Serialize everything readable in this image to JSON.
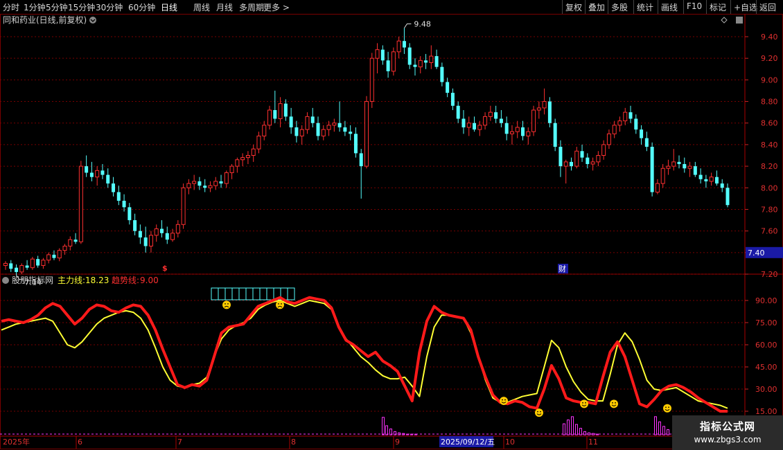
{
  "toolbar": {
    "periods": [
      "分时",
      "1分钟",
      "5分钟",
      "15分钟",
      "30分钟",
      "60分钟",
      "日线",
      "周线",
      "月线",
      "多周期",
      "更多 >"
    ],
    "active_period": "日线",
    "right_buttons": [
      "复权",
      "叠加",
      "多股",
      "统计",
      "画线",
      "F10",
      "标记",
      "+自选",
      "返回"
    ]
  },
  "main_panel": {
    "title": "同和药业(日线,前复权)",
    "high_label": "9.48",
    "low_label": "7.14",
    "current_price": "7.40",
    "marker_s": "$",
    "marker_cai": "财",
    "y_ticks": [
      "9.40",
      "9.20",
      "9.00",
      "8.80",
      "8.60",
      "8.40",
      "8.20",
      "8.00",
      "7.80",
      "7.60",
      "7.40",
      "7.20"
    ]
  },
  "indicator_panel": {
    "name": "股朋指标网",
    "line1_label": "主力线:",
    "line1_value": "18.23",
    "line2_label": "趋势线:",
    "line2_value": "9.00",
    "y_ticks": [
      "90.00",
      "75.00",
      "60.00",
      "45.00",
      "30.00",
      "15.00"
    ]
  },
  "date_axis": {
    "year_label": "2025年",
    "month_labels": [
      "6",
      "7",
      "8",
      "9",
      "10",
      "11"
    ],
    "cursor_date": "2025/09/12/五"
  },
  "watermark": {
    "line1": "指标公式网",
    "line2": "www.zbgs3.com"
  },
  "colors": {
    "up": "#ff3030",
    "down": "#54ffff",
    "trend": "#ff1a1a",
    "main": "#ffff33",
    "volume": "#ff33ff",
    "grid": "#7a0000"
  },
  "chart_data": {
    "type": "candlestick",
    "price_axis_ylim": [
      7.1,
      9.55
    ],
    "indicator_ylim": [
      8,
      102
    ],
    "candles_ohlc": [
      [
        7.28,
        7.32,
        7.24,
        7.3
      ],
      [
        7.3,
        7.33,
        7.22,
        7.25
      ],
      [
        7.26,
        7.29,
        7.19,
        7.22
      ],
      [
        7.22,
        7.3,
        7.2,
        7.28
      ],
      [
        7.28,
        7.33,
        7.24,
        7.26
      ],
      [
        7.26,
        7.36,
        7.24,
        7.34
      ],
      [
        7.34,
        7.37,
        7.26,
        7.28
      ],
      [
        7.28,
        7.35,
        7.25,
        7.33
      ],
      [
        7.33,
        7.4,
        7.3,
        7.38
      ],
      [
        7.38,
        7.42,
        7.33,
        7.35
      ],
      [
        7.35,
        7.44,
        7.32,
        7.42
      ],
      [
        7.42,
        7.48,
        7.38,
        7.46
      ],
      [
        7.46,
        7.55,
        7.42,
        7.52
      ],
      [
        7.52,
        7.58,
        7.48,
        7.5
      ],
      [
        7.5,
        8.25,
        7.48,
        8.2
      ],
      [
        8.2,
        8.3,
        8.1,
        8.14
      ],
      [
        8.14,
        8.24,
        8.06,
        8.1
      ],
      [
        8.1,
        8.2,
        8.02,
        8.16
      ],
      [
        8.16,
        8.22,
        8.08,
        8.12
      ],
      [
        8.12,
        8.18,
        8.0,
        8.04
      ],
      [
        8.04,
        8.1,
        7.92,
        7.96
      ],
      [
        7.96,
        8.02,
        7.84,
        7.88
      ],
      [
        7.88,
        7.94,
        7.78,
        7.82
      ],
      [
        7.82,
        7.86,
        7.66,
        7.7
      ],
      [
        7.7,
        7.76,
        7.56,
        7.6
      ],
      [
        7.6,
        7.66,
        7.48,
        7.54
      ],
      [
        7.54,
        7.64,
        7.4,
        7.46
      ],
      [
        7.46,
        7.6,
        7.4,
        7.56
      ],
      [
        7.56,
        7.66,
        7.5,
        7.62
      ],
      [
        7.62,
        7.7,
        7.54,
        7.58
      ],
      [
        7.58,
        7.64,
        7.48,
        7.52
      ],
      [
        7.52,
        7.62,
        7.5,
        7.58
      ],
      [
        7.58,
        7.7,
        7.54,
        7.66
      ],
      [
        7.66,
        8.04,
        7.62,
        8.0
      ],
      [
        8.0,
        8.08,
        7.94,
        8.04
      ],
      [
        8.04,
        8.12,
        7.98,
        8.06
      ],
      [
        8.06,
        8.1,
        7.98,
        8.02
      ],
      [
        8.02,
        8.08,
        7.96,
        8.0
      ],
      [
        8.0,
        8.06,
        7.96,
        8.02
      ],
      [
        8.02,
        8.1,
        7.98,
        8.06
      ],
      [
        8.06,
        8.12,
        8.0,
        8.04
      ],
      [
        8.04,
        8.16,
        8.0,
        8.14
      ],
      [
        8.14,
        8.22,
        8.08,
        8.2
      ],
      [
        8.2,
        8.28,
        8.14,
        8.26
      ],
      [
        8.26,
        8.32,
        8.2,
        8.28
      ],
      [
        8.28,
        8.34,
        8.22,
        8.3
      ],
      [
        8.3,
        8.4,
        8.24,
        8.36
      ],
      [
        8.36,
        8.52,
        8.32,
        8.48
      ],
      [
        8.48,
        8.62,
        8.44,
        8.58
      ],
      [
        8.58,
        8.76,
        8.54,
        8.72
      ],
      [
        8.72,
        8.9,
        8.6,
        8.64
      ],
      [
        8.64,
        8.84,
        8.56,
        8.78
      ],
      [
        8.78,
        8.82,
        8.62,
        8.66
      ],
      [
        8.66,
        8.74,
        8.5,
        8.56
      ],
      [
        8.56,
        8.62,
        8.42,
        8.48
      ],
      [
        8.48,
        8.58,
        8.4,
        8.54
      ],
      [
        8.54,
        8.7,
        8.5,
        8.66
      ],
      [
        8.66,
        8.74,
        8.56,
        8.6
      ],
      [
        8.6,
        8.66,
        8.44,
        8.48
      ],
      [
        8.48,
        8.58,
        8.44,
        8.54
      ],
      [
        8.54,
        8.62,
        8.48,
        8.58
      ],
      [
        8.58,
        8.64,
        8.52,
        8.6
      ],
      [
        8.6,
        8.8,
        8.52,
        8.56
      ],
      [
        8.56,
        8.62,
        8.48,
        8.52
      ],
      [
        8.52,
        8.58,
        8.44,
        8.5
      ],
      [
        8.5,
        8.56,
        8.28,
        8.32
      ],
      [
        8.32,
        8.36,
        7.9,
        8.2
      ],
      [
        8.2,
        8.85,
        8.18,
        8.8
      ],
      [
        8.8,
        9.25,
        8.74,
        9.2
      ],
      [
        9.2,
        9.34,
        9.06,
        9.28
      ],
      [
        9.28,
        9.32,
        9.14,
        9.18
      ],
      [
        9.18,
        9.26,
        9.02,
        9.08
      ],
      [
        9.08,
        9.3,
        9.04,
        9.26
      ],
      [
        9.26,
        9.4,
        9.2,
        9.36
      ],
      [
        9.36,
        9.48,
        9.24,
        9.3
      ],
      [
        9.3,
        9.34,
        9.1,
        9.14
      ],
      [
        9.14,
        9.2,
        9.04,
        9.12
      ],
      [
        9.12,
        9.22,
        9.06,
        9.18
      ],
      [
        9.18,
        9.24,
        9.1,
        9.16
      ],
      [
        9.16,
        9.32,
        9.1,
        9.22
      ],
      [
        9.22,
        9.28,
        9.1,
        9.12
      ],
      [
        9.12,
        9.16,
        8.94,
        8.98
      ],
      [
        8.98,
        9.02,
        8.84,
        8.88
      ],
      [
        8.88,
        8.92,
        8.72,
        8.76
      ],
      [
        8.76,
        8.8,
        8.6,
        8.64
      ],
      [
        8.64,
        8.72,
        8.5,
        8.56
      ],
      [
        8.56,
        8.66,
        8.48,
        8.6
      ],
      [
        8.6,
        8.66,
        8.52,
        8.54
      ],
      [
        8.54,
        8.62,
        8.48,
        8.58
      ],
      [
        8.58,
        8.7,
        8.54,
        8.66
      ],
      [
        8.66,
        8.76,
        8.62,
        8.7
      ],
      [
        8.7,
        8.76,
        8.6,
        8.64
      ],
      [
        8.64,
        8.72,
        8.56,
        8.6
      ],
      [
        8.6,
        8.66,
        8.44,
        8.5
      ],
      [
        8.5,
        8.58,
        8.4,
        8.52
      ],
      [
        8.52,
        8.62,
        8.46,
        8.56
      ],
      [
        8.56,
        8.62,
        8.44,
        8.48
      ],
      [
        8.48,
        8.56,
        8.4,
        8.52
      ],
      [
        8.52,
        8.76,
        8.48,
        8.72
      ],
      [
        8.72,
        8.8,
        8.64,
        8.74
      ],
      [
        8.74,
        8.92,
        8.68,
        8.8
      ],
      [
        8.8,
        8.84,
        8.56,
        8.6
      ],
      [
        8.6,
        8.64,
        8.34,
        8.38
      ],
      [
        8.38,
        8.44,
        8.1,
        8.2
      ],
      [
        8.2,
        8.26,
        8.04,
        8.24
      ],
      [
        8.24,
        8.28,
        8.16,
        8.2
      ],
      [
        8.2,
        8.38,
        8.18,
        8.34
      ],
      [
        8.34,
        8.4,
        8.24,
        8.28
      ],
      [
        8.28,
        8.32,
        8.18,
        8.22
      ],
      [
        8.22,
        8.28,
        8.16,
        8.24
      ],
      [
        8.24,
        8.34,
        8.2,
        8.3
      ],
      [
        8.3,
        8.44,
        8.26,
        8.4
      ],
      [
        8.4,
        8.54,
        8.36,
        8.5
      ],
      [
        8.5,
        8.62,
        8.46,
        8.58
      ],
      [
        8.58,
        8.66,
        8.52,
        8.62
      ],
      [
        8.62,
        8.74,
        8.58,
        8.7
      ],
      [
        8.7,
        8.76,
        8.6,
        8.64
      ],
      [
        8.64,
        8.68,
        8.5,
        8.54
      ],
      [
        8.54,
        8.58,
        8.4,
        8.46
      ],
      [
        8.46,
        8.52,
        8.34,
        8.38
      ],
      [
        8.38,
        8.42,
        7.92,
        7.96
      ],
      [
        7.96,
        8.08,
        7.94,
        8.04
      ],
      [
        8.04,
        8.22,
        8.0,
        8.18
      ],
      [
        8.18,
        8.26,
        8.12,
        8.2
      ],
      [
        8.2,
        8.36,
        8.16,
        8.24
      ],
      [
        8.24,
        8.3,
        8.18,
        8.22
      ],
      [
        8.22,
        8.28,
        8.14,
        8.18
      ],
      [
        8.18,
        8.24,
        8.1,
        8.2
      ],
      [
        8.2,
        8.24,
        8.1,
        8.12
      ],
      [
        8.12,
        8.18,
        8.04,
        8.08
      ],
      [
        8.08,
        8.12,
        8.0,
        8.06
      ],
      [
        8.06,
        8.14,
        8.02,
        8.1
      ],
      [
        8.1,
        8.16,
        8.02,
        8.04
      ],
      [
        8.04,
        8.08,
        7.96,
        8.0
      ],
      [
        8.0,
        8.04,
        7.82,
        7.84
      ]
    ],
    "trend_line": [
      76,
      77,
      76,
      75,
      77,
      80,
      85,
      88,
      86,
      80,
      74,
      78,
      84,
      87,
      86,
      83,
      82,
      85,
      87,
      86,
      80,
      70,
      57,
      45,
      33,
      31,
      33,
      32,
      36,
      52,
      68,
      72,
      73,
      74,
      80,
      86,
      88,
      90,
      92,
      89,
      88,
      90,
      92,
      91,
      90,
      85,
      72,
      63,
      60,
      56,
      52,
      55,
      49,
      46,
      42,
      32,
      22,
      55,
      76,
      86,
      82,
      80,
      79,
      78,
      70,
      52,
      38,
      26,
      21,
      20,
      22,
      21,
      18,
      17,
      30,
      46,
      37,
      24,
      22,
      21,
      21,
      20,
      38,
      55,
      62,
      52,
      36,
      20,
      18,
      23,
      29,
      32,
      33,
      31,
      28,
      24,
      21,
      18,
      15,
      15
    ],
    "main_line": [
      70,
      72,
      74,
      75,
      76,
      77,
      78,
      76,
      68,
      60,
      58,
      62,
      68,
      74,
      78,
      80,
      82,
      83,
      82,
      78,
      70,
      58,
      45,
      36,
      32,
      31,
      33,
      34,
      38,
      52,
      64,
      70,
      73,
      75,
      78,
      84,
      87,
      89,
      90,
      88,
      86,
      88,
      90,
      89,
      88,
      84,
      72,
      64,
      58,
      52,
      48,
      43,
      39,
      37,
      37,
      38,
      32,
      25,
      52,
      72,
      80,
      80,
      79,
      78,
      68,
      52,
      36,
      24,
      21,
      21,
      23,
      25,
      26,
      27,
      45,
      63,
      58,
      45,
      35,
      28,
      23,
      22,
      22,
      40,
      60,
      68,
      62,
      50,
      36,
      30,
      29,
      30,
      31,
      28,
      25,
      22,
      21,
      20,
      19,
      17
    ],
    "volume_bars": [
      0,
      0,
      0,
      0,
      0,
      0,
      0,
      0,
      0,
      0,
      0,
      0,
      0,
      0,
      0,
      0,
      0,
      0,
      0,
      0,
      0,
      0,
      0,
      0,
      0,
      0,
      0,
      0,
      0,
      0,
      0,
      0,
      0,
      0,
      0,
      0,
      0,
      0,
      0,
      0,
      0,
      0,
      0,
      0,
      0,
      0,
      0,
      0,
      0,
      0,
      0,
      0,
      0,
      0,
      0,
      27,
      14,
      9,
      5,
      3,
      2,
      1,
      1,
      1,
      0,
      0,
      0,
      0,
      0,
      0,
      0,
      0,
      0,
      0,
      0,
      0,
      0,
      0,
      0,
      0,
      0,
      0,
      0,
      0,
      0,
      0,
      0,
      0,
      0,
      0,
      0,
      0,
      0,
      0,
      0,
      0,
      0,
      0,
      0,
      0,
      0,
      0,
      0,
      0,
      0,
      0,
      0,
      0,
      0,
      0,
      0,
      0,
      0,
      0,
      0,
      0,
      0,
      0,
      0,
      0,
      0,
      0,
      0,
      0,
      0,
      0,
      0,
      0,
      0,
      0,
      0,
      0,
      0,
      0,
      0,
      0,
      0,
      0,
      0,
      0,
      0,
      0,
      0,
      0,
      0,
      0,
      0,
      0,
      0,
      0,
      0,
      0,
      0,
      0,
      0,
      0,
      0,
      0,
      0,
      0,
      0,
      0,
      0,
      0,
      0,
      0,
      0,
      0,
      0,
      0,
      0,
      0,
      0,
      0,
      0,
      0,
      0,
      0,
      0,
      0,
      0,
      0,
      0,
      0,
      0,
      0,
      0,
      0,
      0,
      0,
      0,
      0,
      0,
      0,
      0,
      0,
      0,
      0,
      0,
      0,
      0,
      0,
      0,
      0,
      0,
      0,
      0,
      0,
      0,
      0,
      0,
      0,
      0,
      0,
      0,
      0,
      0,
      0,
      0,
      0,
      0,
      0,
      0,
      0,
      0,
      0,
      0,
      0,
      0,
      0,
      0,
      0,
      0
    ],
    "volume_sparse": [
      [
        553,
        27
      ],
      [
        558,
        14
      ],
      [
        564,
        9
      ],
      [
        570,
        5
      ],
      [
        576,
        3
      ],
      [
        582,
        2
      ],
      [
        588,
        1
      ],
      [
        594,
        1
      ],
      [
        600,
        1
      ],
      [
        814,
        17
      ],
      [
        820,
        23
      ],
      [
        826,
        28
      ],
      [
        832,
        16
      ],
      [
        838,
        10
      ],
      [
        844,
        5
      ],
      [
        850,
        3
      ],
      [
        856,
        2
      ],
      [
        862,
        1
      ],
      [
        946,
        28
      ],
      [
        952,
        20
      ],
      [
        958,
        13
      ],
      [
        964,
        8
      ]
    ],
    "volume_ylim": [
      0,
      30
    ],
    "smileys_happy": [
      [
        727,
        22
      ],
      [
        778,
        14
      ],
      [
        843,
        20
      ],
      [
        886,
        20
      ],
      [
        963,
        17
      ]
    ],
    "smileys_sad": [
      [
        327,
        87
      ],
      [
        404,
        87
      ]
    ]
  }
}
